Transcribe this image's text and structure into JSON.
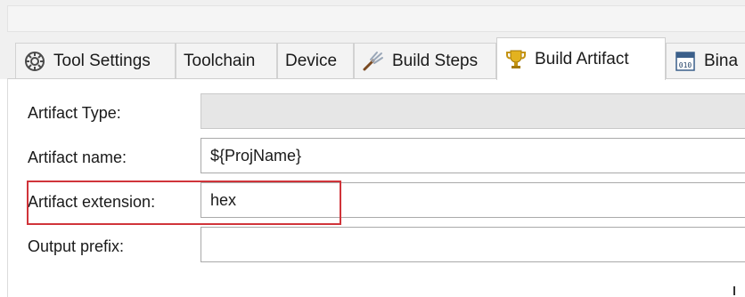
{
  "tabs": [
    {
      "label": "Tool Settings",
      "icon": "tool-settings-icon",
      "active": false
    },
    {
      "label": "Toolchain",
      "icon": null,
      "active": false
    },
    {
      "label": "Device",
      "icon": null,
      "active": false
    },
    {
      "label": "Build Steps",
      "icon": "build-steps-icon",
      "active": false
    },
    {
      "label": "Build Artifact",
      "icon": "trophy-icon",
      "active": true
    },
    {
      "label": "Bina",
      "icon": "binary-icon",
      "active": false
    }
  ],
  "fields": {
    "artifact_type": {
      "label": "Artifact Type:",
      "value": ""
    },
    "artifact_name": {
      "label": "Artifact name:",
      "value": "${ProjName}"
    },
    "artifact_extension": {
      "label": "Artifact extension:",
      "value": "hex"
    },
    "output_prefix": {
      "label": "Output prefix:",
      "value": ""
    }
  },
  "colors": {
    "highlight": "#d0343a",
    "tab_bg": "#f3f3f3",
    "active_tab_bg": "#ffffff",
    "disabled_field_bg": "#e6e6e6"
  }
}
